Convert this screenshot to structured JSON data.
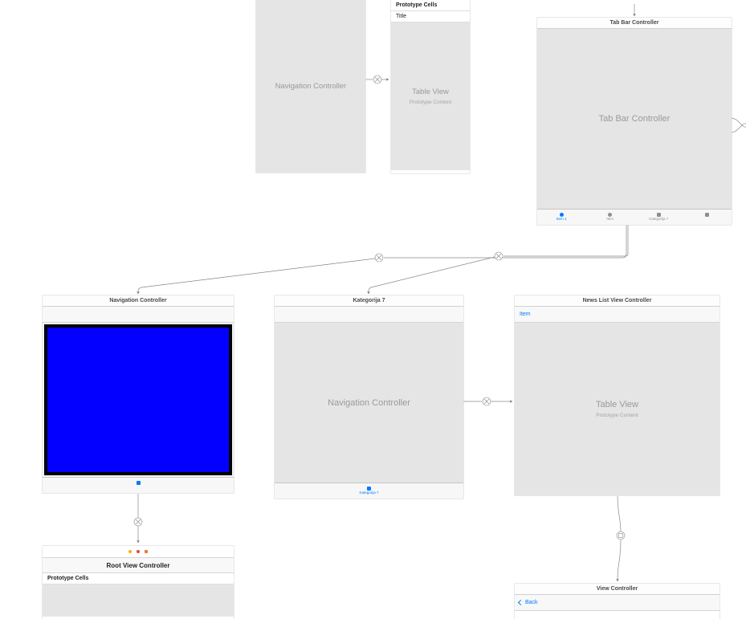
{
  "top_nav_controller": {
    "body_text": "Navigation Controller"
  },
  "top_table_scene": {
    "proto_header": "Prototype Cells",
    "cell_title": "Title",
    "tv_title": "Table View",
    "tv_sub": "Prototype Content"
  },
  "tab_bar_controller": {
    "title": "Tab Bar Controller",
    "body_text": "Tab Bar Controller",
    "items": [
      {
        "label": "Item 1",
        "icon": "circle",
        "selected": true
      },
      {
        "label": "Item",
        "icon": "circle",
        "selected": false
      },
      {
        "label": "Kategorija 7",
        "icon": "square",
        "selected": false
      },
      {
        "label": "",
        "icon": "square",
        "selected": false
      }
    ]
  },
  "nav_controller_blue": {
    "title": "Navigation Controller",
    "tab_label": ""
  },
  "root_vc": {
    "title": "Root View Controller",
    "proto_header": "Prototype Cells"
  },
  "kategorija_nav": {
    "title": "Kategorija 7",
    "body_text": "Navigation Controller",
    "tab_label": "Kategorija 7"
  },
  "news_list": {
    "title": "News List View Controller",
    "item_label": "Item",
    "tv_title": "Table View",
    "tv_sub": "Prototype Content"
  },
  "view_controller": {
    "title": "View Controller",
    "back_label": "Back"
  }
}
